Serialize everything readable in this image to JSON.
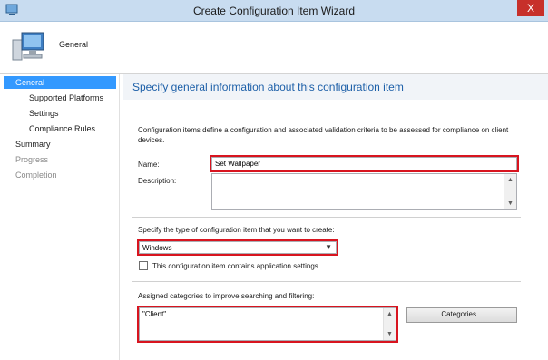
{
  "window": {
    "title": "Create Configuration Item Wizard",
    "close_glyph": "X"
  },
  "header": {
    "label": "General",
    "icon": "computer-icon"
  },
  "nav": {
    "items": [
      {
        "label": "General",
        "state": "selected"
      },
      {
        "label": "Supported Platforms",
        "state": "sub"
      },
      {
        "label": "Settings",
        "state": "sub"
      },
      {
        "label": "Compliance Rules",
        "state": "sub"
      },
      {
        "label": "Summary",
        "state": "normal"
      },
      {
        "label": "Progress",
        "state": "disabled"
      },
      {
        "label": "Completion",
        "state": "disabled"
      }
    ]
  },
  "content": {
    "title": "Specify general information about this configuration item",
    "description": "Configuration items define a configuration and associated validation criteria to be assessed for compliance on client devices.",
    "name_label": "Name:",
    "name_value": "Set Wallpaper",
    "description_label": "Description:",
    "description_value": "",
    "type_label": "Specify the type of configuration item that you want to create:",
    "type_value": "Windows",
    "app_settings_label": "This configuration item contains application settings",
    "app_settings_checked": false,
    "categories_label": "Assigned categories to improve searching and filtering:",
    "categories_value": "\"Client\"",
    "categories_button": "Categories..."
  },
  "colors": {
    "highlight": "#d8141f",
    "selection": "#3399ff",
    "title_text": "#1c5fa8"
  }
}
